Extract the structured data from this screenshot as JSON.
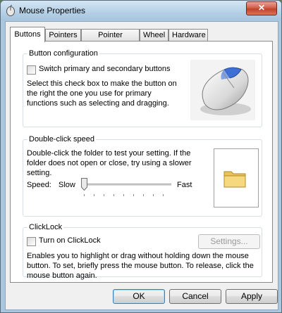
{
  "window": {
    "title": "Mouse Properties",
    "close_glyph": "✕"
  },
  "tabs": [
    {
      "label": "Buttons",
      "active": true
    },
    {
      "label": "Pointers",
      "active": false
    },
    {
      "label": "Pointer Options",
      "active": false
    },
    {
      "label": "Wheel",
      "active": false
    },
    {
      "label": "Hardware",
      "active": false
    }
  ],
  "button_configuration": {
    "legend": "Button configuration",
    "switch_label": "Switch primary and secondary buttons",
    "switch_checked": false,
    "description": "Select this check box to make the button on the right the one you use for primary functions such as selecting and dragging.",
    "image_icon": "mouse-icon"
  },
  "double_click": {
    "legend": "Double-click speed",
    "description": "Double-click the folder to test your setting. If the folder does not open or close, try using a slower setting.",
    "speed_label": "Speed:",
    "slow_label": "Slow",
    "fast_label": "Fast",
    "speed_value_fraction": 0.0,
    "test_icon": "folder-icon"
  },
  "clicklock": {
    "legend": "ClickLock",
    "turn_on_label": "Turn on ClickLock",
    "turn_on_checked": false,
    "settings_label": "Settings...",
    "description": "Enables you to highlight or drag without holding down the mouse button. To set, briefly press the mouse button. To release, click the mouse button again."
  },
  "footer": {
    "ok_label": "OK",
    "cancel_label": "Cancel",
    "apply_label": "Apply"
  }
}
